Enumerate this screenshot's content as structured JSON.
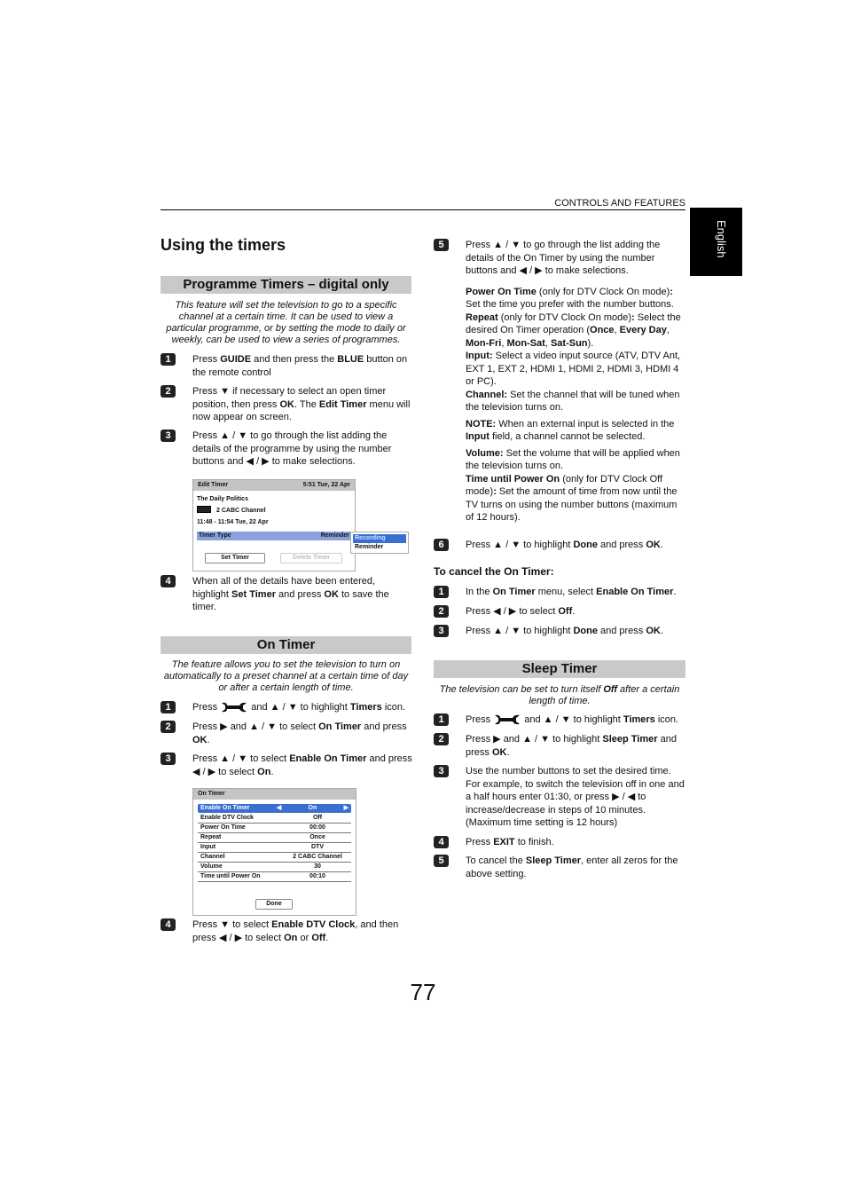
{
  "header": {
    "section": "CONTROLS AND FEATURES",
    "language_tab": "English",
    "title": "Using the timers",
    "page_number": "77"
  },
  "programme": {
    "heading": "Programme Timers – digital only",
    "intro": "This feature will set the television to go to a specific channel at a certain time. It can be used to view a particular programme, or by setting the mode to daily or weekly, can be used to view a series of programmes.",
    "steps": [
      {
        "n": "1",
        "p": [
          [
            {
              "t": "Press "
            },
            {
              "t": "GUIDE",
              "b": 1
            },
            {
              "t": " and then press the "
            },
            {
              "t": "BLUE",
              "b": 1
            },
            {
              "t": " button on the remote control"
            }
          ]
        ]
      },
      {
        "n": "2",
        "p": [
          [
            {
              "t": "Press ▼ if necessary to select an open timer position, then press "
            },
            {
              "t": "OK",
              "b": 1
            },
            {
              "t": ". The "
            },
            {
              "t": "Edit Timer",
              "b": 1
            },
            {
              "t": " menu will now appear on screen."
            }
          ]
        ]
      },
      {
        "n": "3",
        "p": [
          [
            {
              "t": "Press ▲ / ▼ to go through the list adding the details of the programme by using the number buttons and ◀ / ▶ to make selections."
            }
          ]
        ]
      },
      {
        "n": "4",
        "p": [
          [
            {
              "t": "When all of the details have been entered, highlight "
            },
            {
              "t": "Set Timer",
              "b": 1
            },
            {
              "t": " and press "
            },
            {
              "t": "OK",
              "b": 1
            },
            {
              "t": " to save the timer."
            }
          ]
        ]
      }
    ],
    "screen": {
      "title": "Edit Timer",
      "clock": "5:51 Tue, 22 Apr",
      "programme": "The Daily Politics",
      "channel": "2  CABC  Channel",
      "time": "11:48 - 11:54 Tue, 22 Apr",
      "timer_type_label": "Timer Type",
      "timer_type_value": "Reminder",
      "options": [
        "Recording",
        "Reminder"
      ],
      "set_button": "Set Timer",
      "delete_button": "Delete Timer"
    }
  },
  "on_timer": {
    "heading": "On Timer",
    "intro": "The feature allows you to set the television to turn on automatically to a preset channel at a certain time of day or after a certain length of time.",
    "steps": [
      {
        "n": "1",
        "p": [
          [
            {
              "t": "Press "
            },
            {
              "icon": "setup-icon"
            },
            {
              "t": " and ▲ / ▼ to highlight "
            },
            {
              "t": "Timers",
              "b": 1
            },
            {
              "t": " icon."
            }
          ]
        ]
      },
      {
        "n": "2",
        "p": [
          [
            {
              "t": "Press ▶ and ▲  / ▼ to select "
            },
            {
              "t": "On Timer",
              "b": 1
            },
            {
              "t": " and press "
            },
            {
              "t": "OK",
              "b": 1
            },
            {
              "t": "."
            }
          ]
        ]
      },
      {
        "n": "3",
        "p": [
          [
            {
              "t": "Press ▲ / ▼ to select "
            },
            {
              "t": "Enable On Timer",
              "b": 1
            },
            {
              "t": " and press ◀ / ▶ to select "
            },
            {
              "t": "On",
              "b": 1
            },
            {
              "t": "."
            }
          ]
        ]
      },
      {
        "n": "4",
        "p": [
          [
            {
              "t": "Press ▼ to select "
            },
            {
              "t": "Enable DTV Clock",
              "b": 1
            },
            {
              "t": ", and then press ◀ / ▶ to select "
            },
            {
              "t": "On",
              "b": 1
            },
            {
              "t": " or "
            },
            {
              "t": "Off",
              "b": 1
            },
            {
              "t": "."
            }
          ]
        ]
      }
    ],
    "screen": {
      "title": "On Timer",
      "rows": [
        {
          "label": "Enable On Timer",
          "value": "On",
          "selected": true
        },
        {
          "label": "Enable DTV Clock",
          "value": "Off"
        },
        {
          "label": "Power On Time",
          "value": "00:00"
        },
        {
          "label": "Repeat",
          "value": "Once"
        },
        {
          "label": "Input",
          "value": "DTV"
        },
        {
          "label": "Channel",
          "value": "2 CABC Channel"
        },
        {
          "label": "Volume",
          "value": "30"
        },
        {
          "label": "Time until Power On",
          "value": "00:10"
        }
      ],
      "done_button": "Done"
    },
    "steps_right": [
      {
        "n": "5",
        "p": [
          [
            {
              "t": "Press ▲ / ▼ to go through the list adding the details of the On Timer by using the number buttons and ◀ / ▶ to make selections."
            }
          ],
          [
            {
              "t": "Power On Time",
              "b": 1
            },
            {
              "t": " (only for DTV Clock On mode)"
            },
            {
              "t": ":",
              "b": 1
            },
            {
              "t": " Set the time you prefer with the number buttons. "
            },
            {
              "t": "Repeat",
              "b": 1
            },
            {
              "t": " (only for DTV Clock On mode)"
            },
            {
              "t": ":",
              "b": 1
            },
            {
              "t": " Select the desired On Timer operation ("
            },
            {
              "t": "Once",
              "b": 1
            },
            {
              "t": ", "
            },
            {
              "t": "Every Day",
              "b": 1
            },
            {
              "t": ", "
            },
            {
              "t": "Mon-Fri",
              "b": 1
            },
            {
              "t": ", "
            },
            {
              "t": "Mon-Sat",
              "b": 1
            },
            {
              "t": ", "
            },
            {
              "t": "Sat-Sun",
              "b": 1
            },
            {
              "t": ")."
            },
            {
              "br": 1
            },
            {
              "t": "Input:",
              "b": 1
            },
            {
              "t": " Select a video input source (ATV, DTV Ant, EXT 1, EXT 2, HDMI 1, HDMI 2, HDMI 3, HDMI 4 or PC)."
            },
            {
              "br": 1
            },
            {
              "t": "Channel:",
              "b": 1
            },
            {
              "t": " Set the channel that will be tuned when the television turns on."
            }
          ],
          [
            {
              "t": "NOTE:",
              "b": 1
            },
            {
              "t": " When an external input is selected in the "
            },
            {
              "t": "Input",
              "b": 1
            },
            {
              "t": " field, a channel cannot be selected."
            }
          ],
          [
            {
              "t": "Volume:",
              "b": 1
            },
            {
              "t": " Set the volume that will be applied when the television turns on."
            },
            {
              "br": 1
            },
            {
              "t": "Time until Power On",
              "b": 1
            },
            {
              "t": " (only for DTV Clock Off mode)"
            },
            {
              "t": ":",
              "b": 1
            },
            {
              "t": " Set the amount of time from now until the TV turns on using the number buttons (maximum of 12 hours)."
            }
          ]
        ]
      },
      {
        "n": "6",
        "p": [
          [
            {
              "t": "Press ▲ / ▼ to highlight "
            },
            {
              "t": "Done",
              "b": 1
            },
            {
              "t": " and press "
            },
            {
              "t": "OK",
              "b": 1
            },
            {
              "t": "."
            }
          ]
        ]
      }
    ]
  },
  "cancel": {
    "heading": "To cancel the On Timer:",
    "steps": [
      {
        "n": "1",
        "p": [
          [
            {
              "t": "In the "
            },
            {
              "t": "On Timer",
              "b": 1
            },
            {
              "t": " menu, select "
            },
            {
              "t": "Enable On Timer",
              "b": 1
            },
            {
              "t": "."
            }
          ]
        ]
      },
      {
        "n": "2",
        "p": [
          [
            {
              "t": "Press ◀ / ▶ to select "
            },
            {
              "t": "Off",
              "b": 1
            },
            {
              "t": "."
            }
          ]
        ]
      },
      {
        "n": "3",
        "p": [
          [
            {
              "t": "Press ▲ / ▼ to highlight "
            },
            {
              "t": "Done",
              "b": 1
            },
            {
              "t": " and press "
            },
            {
              "t": "OK",
              "b": 1
            },
            {
              "t": "."
            }
          ]
        ]
      }
    ]
  },
  "sleep": {
    "heading": "Sleep Timer",
    "intro": [
      {
        "t": "The television can be set to turn itself "
      },
      {
        "t": "Off",
        "b": 1
      },
      {
        "t": " after a certain length of time."
      }
    ],
    "steps": [
      {
        "n": "1",
        "p": [
          [
            {
              "t": "Press "
            },
            {
              "icon": "setup-icon"
            },
            {
              "t": " and ▲ / ▼ to highlight "
            },
            {
              "t": "Timers",
              "b": 1
            },
            {
              "t": " icon."
            }
          ]
        ]
      },
      {
        "n": "2",
        "p": [
          [
            {
              "t": "Press ▶ and ▲ / ▼ to highlight "
            },
            {
              "t": "Sleep Timer",
              "b": 1
            },
            {
              "t": " and press "
            },
            {
              "t": "OK",
              "b": 1
            },
            {
              "t": "."
            }
          ]
        ]
      },
      {
        "n": "3",
        "p": [
          [
            {
              "t": "Use the number buttons to set the desired time. For example, to switch the television off in one and a half hours enter 01:30, or press ▶ / ◀ to increase/decrease in steps of 10 minutes. (Maximum time setting is 12 hours)"
            }
          ]
        ]
      },
      {
        "n": "4",
        "p": [
          [
            {
              "t": "Press "
            },
            {
              "t": "EXIT",
              "b": 1
            },
            {
              "t": " to finish."
            }
          ]
        ]
      },
      {
        "n": "5",
        "p": [
          [
            {
              "t": "To cancel the "
            },
            {
              "t": "Sleep Timer",
              "b": 1
            },
            {
              "t": ", enter all zeros for the above setting."
            }
          ]
        ]
      }
    ]
  },
  "colors": {
    "section_bar": "#c9c9c9",
    "highlight": "#3a6fd0",
    "timer_type_row": "#8aa2dc",
    "language_tab": "#000000"
  }
}
